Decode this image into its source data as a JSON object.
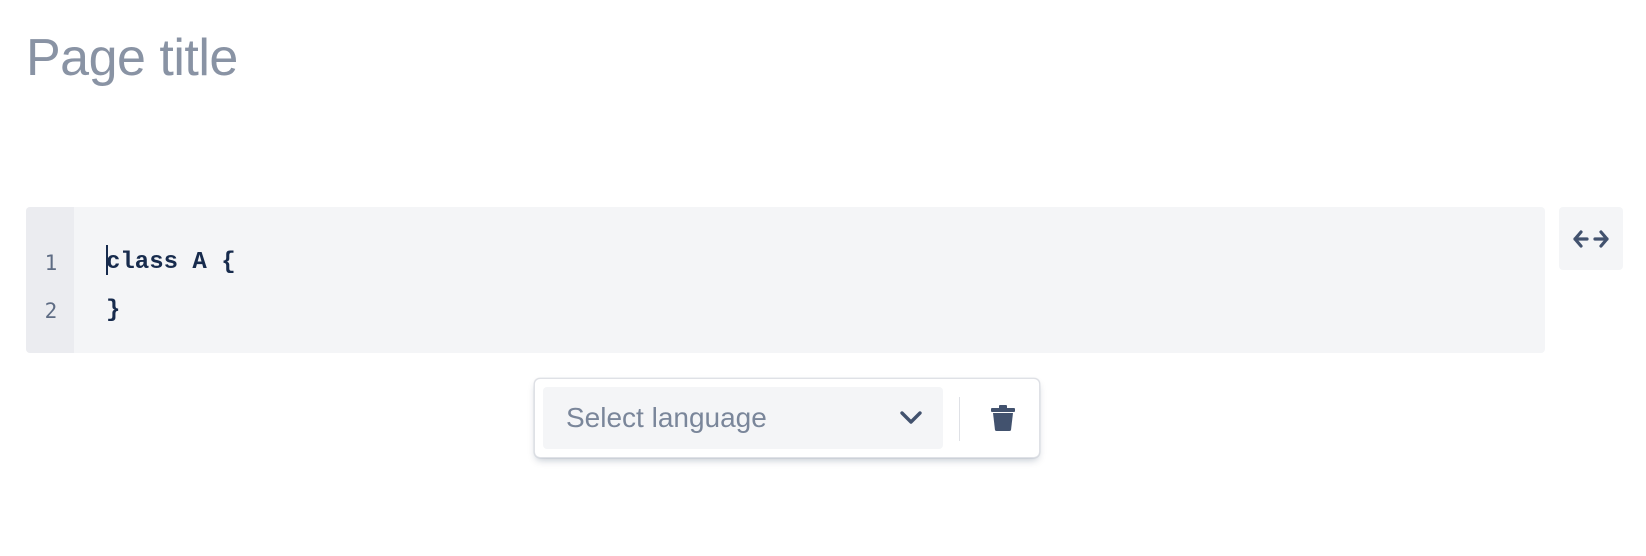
{
  "page": {
    "title": "Page title"
  },
  "code_block": {
    "line_numbers": [
      "1",
      "2"
    ],
    "lines": [
      "class A {",
      "}"
    ]
  },
  "toolbar": {
    "language_select": {
      "placeholder": "Select language"
    },
    "icons": {
      "chevron": "chevron-down-icon",
      "delete": "trash-icon",
      "wrap": "arrows-horizontal-icon"
    }
  },
  "colors": {
    "title": "#8993a4",
    "code_background": "#f4f5f7",
    "gutter_background": "#ebecf0",
    "code_text": "#172b4d",
    "icon": "#42526e"
  }
}
